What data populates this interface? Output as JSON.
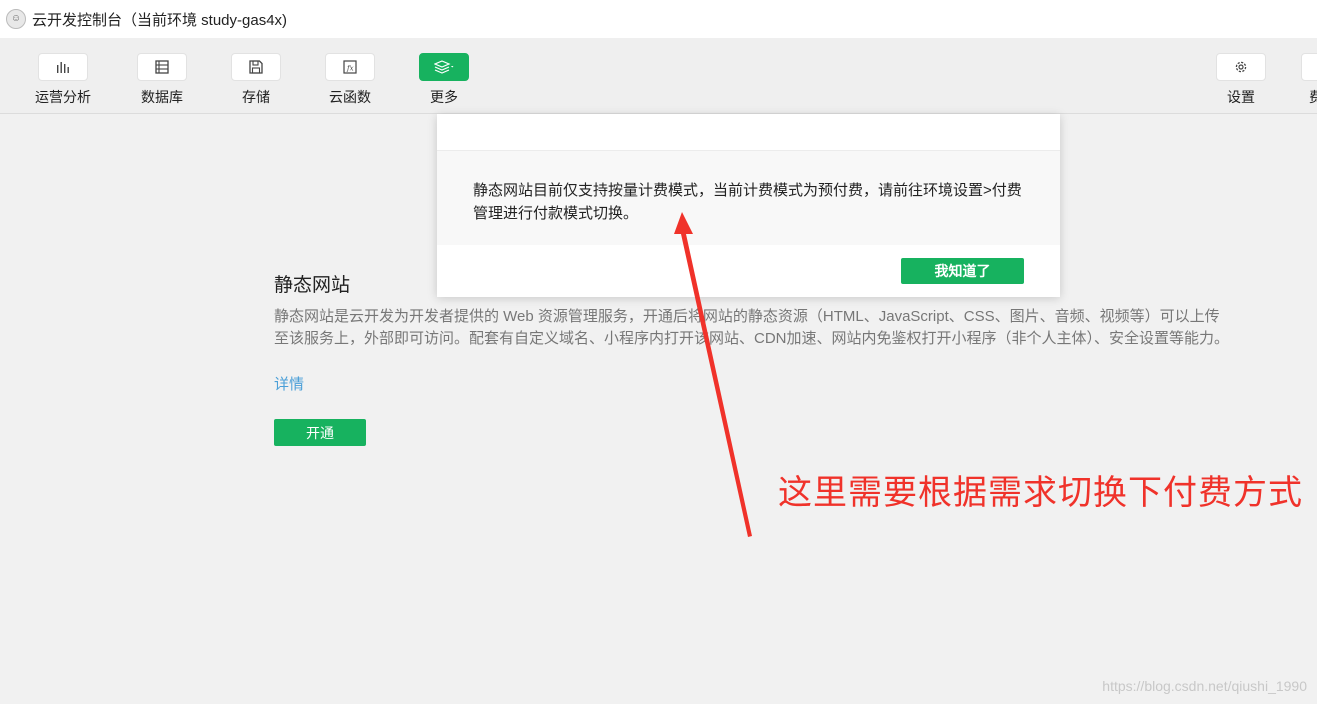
{
  "window": {
    "title": "云开发控制台（当前环境 study-gas4x)",
    "logo_icon": "chat-bubble-icon"
  },
  "toolbar": {
    "items": [
      {
        "label": "运营分析",
        "icon": "bar-chart-icon"
      },
      {
        "label": "数据库",
        "icon": "database-icon"
      },
      {
        "label": "存储",
        "icon": "floppy-disk-icon"
      },
      {
        "label": "云函数",
        "icon": "function-icon"
      },
      {
        "label": "更多",
        "icon": "layers-icon",
        "active": true
      },
      {
        "label": "设置",
        "icon": "gear-icon"
      },
      {
        "label": "费",
        "icon": "",
        "clipped": true
      }
    ]
  },
  "content": {
    "title": "静态网站",
    "description": "静态网站是云开发为开发者提供的 Web 资源管理服务，开通后将网站的静态资源（HTML、JavaScript、CSS、图片、音频、视频等）可以上传至该服务上，外部即可访问。配套有自定义域名、小程序内打开该网站、CDN加速、网站内免鉴权打开小程序（非个人主体）、安全设置等能力。",
    "detail_link": "详情",
    "open_button": "开通"
  },
  "dialog": {
    "message": "静态网站目前仅支持按量计费模式，当前计费模式为预付费，请前往环境设置>付费管理进行付款模式切换。",
    "ok_button": "我知道了"
  },
  "annotation": {
    "text": "这里需要根据需求切换下付费方式",
    "color": "#f0322a"
  },
  "watermark": "https://blog.csdn.net/qiushi_1990",
  "colors": {
    "accent": "#17b25f",
    "link": "#4a9fd8"
  }
}
